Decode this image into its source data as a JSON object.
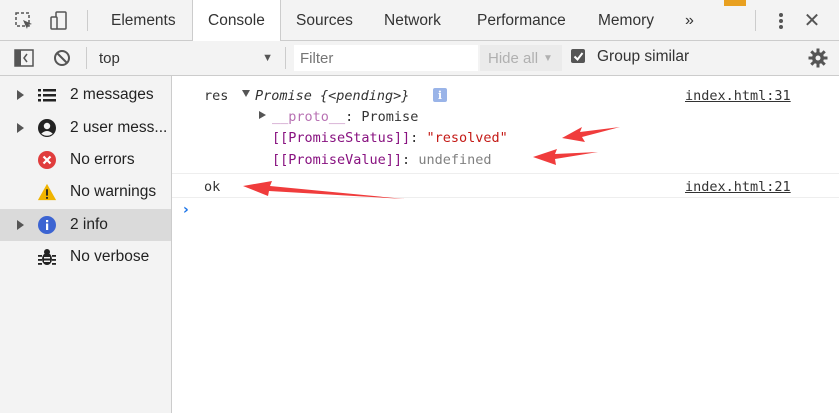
{
  "tabs": [
    {
      "label": "Elements",
      "active": false
    },
    {
      "label": "Console",
      "active": true
    },
    {
      "label": "Sources",
      "active": false
    },
    {
      "label": "Network",
      "active": false
    },
    {
      "label": "Performance",
      "active": false
    },
    {
      "label": "Memory",
      "active": false
    }
  ],
  "toolbar": {
    "context_value": "top",
    "filter_placeholder": "Filter",
    "levels_label": "Hide all",
    "group_similar_label": "Group similar",
    "group_similar_checked": true
  },
  "sidebar": {
    "items": [
      {
        "label": "2 messages",
        "icon": "list-icon",
        "expandable": true
      },
      {
        "label": "2 user mess...",
        "icon": "user-icon",
        "expandable": true
      },
      {
        "label": "No errors",
        "icon": "error-icon",
        "expandable": false
      },
      {
        "label": "No warnings",
        "icon": "warning-icon",
        "expandable": false
      },
      {
        "label": "2 info",
        "icon": "info-icon",
        "expandable": true,
        "selected": true
      },
      {
        "label": "No verbose",
        "icon": "bug-icon",
        "expandable": false
      }
    ]
  },
  "console": {
    "msg1": {
      "prefix": "res",
      "object": "Promise {<pending>}",
      "source": "index.html:31",
      "proto_key": "__proto__",
      "proto_value": "Promise",
      "status_key": "[[PromiseStatus]]",
      "status_value": "\"resolved\"",
      "value_key": "[[PromiseValue]]",
      "value_value": "undefined"
    },
    "msg2": {
      "text": "ok",
      "source": "index.html:21"
    }
  },
  "colors": {
    "accent": "#1a73e8",
    "annotation_arrow": "#f03c3c",
    "error": "#e03c3c",
    "warning": "#f0b400",
    "info": "#3c64d2"
  }
}
